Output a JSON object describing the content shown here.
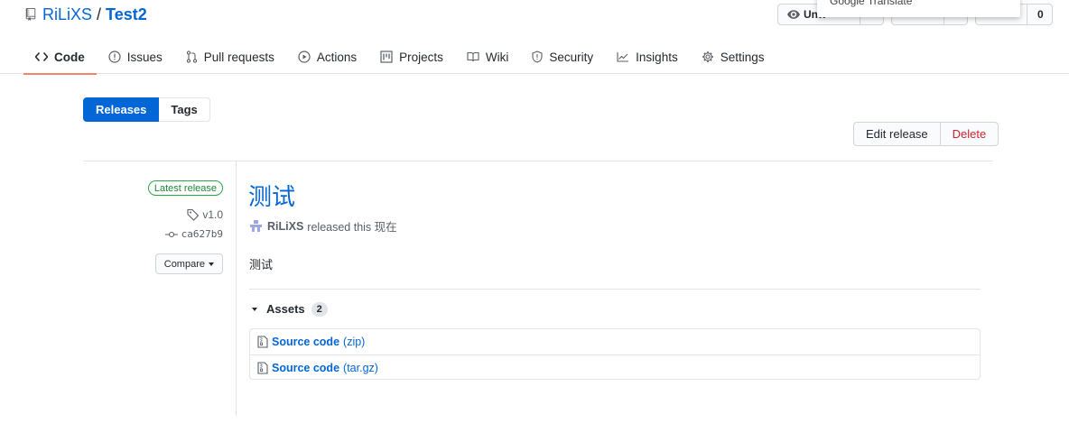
{
  "repo": {
    "owner": "RiLiXS",
    "separator": "/",
    "name": "Test2"
  },
  "header_buttons": {
    "watch_label": "Unw",
    "fork_count": "0"
  },
  "translate_popup": {
    "text": "Google Translate"
  },
  "tabs": [
    {
      "label": "Code",
      "icon": "code-icon",
      "active": true
    },
    {
      "label": "Issues",
      "icon": "issue-icon"
    },
    {
      "label": "Pull requests",
      "icon": "pull-request-icon"
    },
    {
      "label": "Actions",
      "icon": "play-icon"
    },
    {
      "label": "Projects",
      "icon": "project-icon"
    },
    {
      "label": "Wiki",
      "icon": "book-icon"
    },
    {
      "label": "Security",
      "icon": "shield-icon"
    },
    {
      "label": "Insights",
      "icon": "graph-icon"
    },
    {
      "label": "Settings",
      "icon": "gear-icon"
    }
  ],
  "subnav": {
    "releases": "Releases",
    "tags": "Tags"
  },
  "actions": {
    "edit": "Edit release",
    "delete": "Delete"
  },
  "meta": {
    "latest_badge": "Latest release",
    "tag": "v1.0",
    "commit": "ca627b9",
    "compare": "Compare"
  },
  "release": {
    "title": "测试",
    "author": "RiLiXS",
    "released_text": "released this 现在",
    "body": "测试"
  },
  "assets": {
    "heading": "Assets",
    "count": "2",
    "items": [
      {
        "label": "Source code",
        "ext": "(zip)"
      },
      {
        "label": "Source code",
        "ext": "(tar.gz)"
      }
    ]
  },
  "colors": {
    "accent": "#0366d6",
    "active_tab_underline": "#f9826c",
    "danger": "#cb2431",
    "success": "#28a745"
  }
}
